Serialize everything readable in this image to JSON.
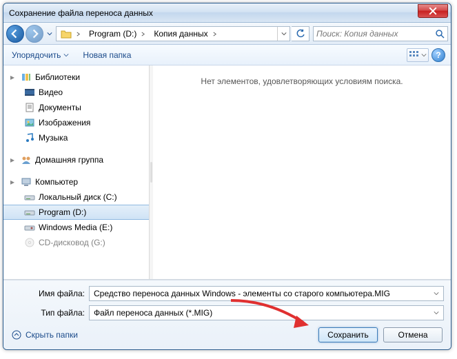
{
  "window": {
    "title": "Сохранение файла переноса данных"
  },
  "breadcrumb": {
    "items": [
      "Program (D:)",
      "Копия данных"
    ]
  },
  "search": {
    "placeholder": "Поиск: Копия данных"
  },
  "toolbar": {
    "organize": "Упорядочить",
    "newfolder": "Новая папка"
  },
  "sidebar": {
    "libraries": {
      "label": "Библиотеки",
      "items": [
        "Видео",
        "Документы",
        "Изображения",
        "Музыка"
      ]
    },
    "homegroup": {
      "label": "Домашняя группа"
    },
    "computer": {
      "label": "Компьютер",
      "items": [
        "Локальный диск (C:)",
        "Program (D:)",
        "Windows Media  (E:)",
        "CD-дисковод (G:)"
      ]
    },
    "selected_index": 1
  },
  "content": {
    "empty_msg": "Нет элементов, удовлетворяющих условиям поиска."
  },
  "fields": {
    "name_label": "Имя файла:",
    "name_value": "Средство переноса данных Windows - элементы со старого компьютера.MIG",
    "type_label": "Тип файла:",
    "type_value": "Файл переноса данных (*.MIG)"
  },
  "buttons": {
    "hide_folders": "Скрыть папки",
    "save": "Сохранить",
    "cancel": "Отмена"
  }
}
